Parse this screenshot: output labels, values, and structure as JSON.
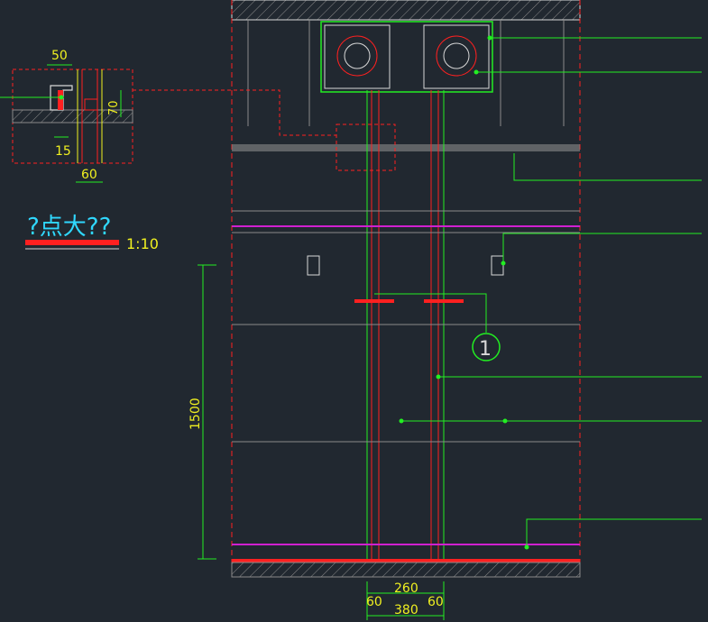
{
  "colors": {
    "background": "#212830",
    "red": "#ff2020",
    "green": "#22ee22",
    "yellow": "#f0f020",
    "magenta": "#d020d0",
    "gray": "#8a8a8a",
    "white": "#d8d8d8",
    "cyan": "#30d8ff",
    "darkred": "#b02020"
  },
  "detail": {
    "title": "?点大??",
    "scale": "1:10",
    "dim_top": "50",
    "dim_side": "70",
    "dim_15": "15",
    "dim_60": "60"
  },
  "elevation": {
    "height_dim": "1500",
    "bottom_dims": {
      "left": "60",
      "middle": "260",
      "right": "60",
      "total": "380"
    },
    "callout_number": "1"
  }
}
